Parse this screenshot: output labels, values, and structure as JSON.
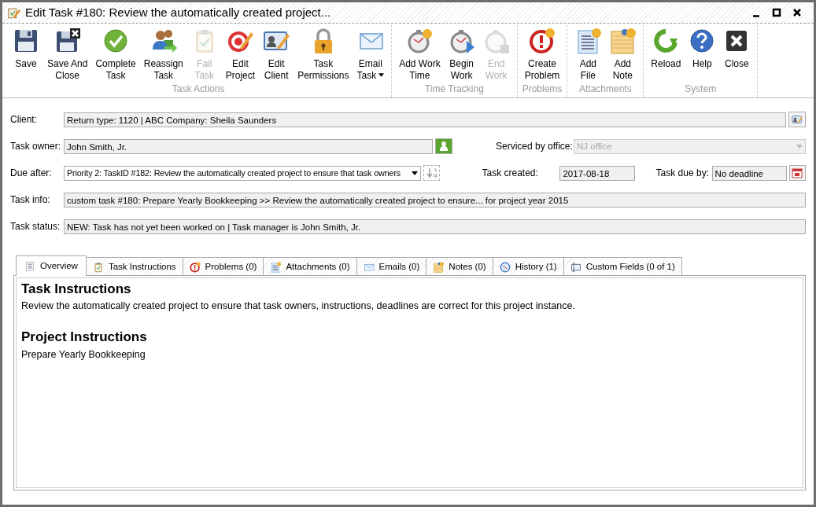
{
  "window": {
    "title": "Edit Task #180: Review the automatically created project..."
  },
  "toolbar_groups": [
    {
      "caption": "Task Actions",
      "buttons": [
        {
          "label": "Save",
          "disabled": false
        },
        {
          "label": "Save And\nClose",
          "disabled": false
        },
        {
          "label": "Complete\nTask",
          "disabled": false
        },
        {
          "label": "Reassign\nTask",
          "disabled": false
        },
        {
          "label": "Fail\nTask",
          "disabled": true
        },
        {
          "label": "Edit\nProject",
          "disabled": false
        },
        {
          "label": "Edit\nClient",
          "disabled": false
        },
        {
          "label": "Task\nPermissions",
          "disabled": false
        },
        {
          "label": "Email\nTask",
          "disabled": false,
          "dropdown": true
        }
      ]
    },
    {
      "caption": "Time Tracking",
      "buttons": [
        {
          "label": "Add Work\nTime",
          "disabled": false
        },
        {
          "label": "Begin\nWork",
          "disabled": false
        },
        {
          "label": "End\nWork",
          "disabled": true
        }
      ]
    },
    {
      "caption": "Problems",
      "buttons": [
        {
          "label": "Create\nProblem",
          "disabled": false
        }
      ]
    },
    {
      "caption": "Attachments",
      "buttons": [
        {
          "label": "Add\nFile",
          "disabled": false
        },
        {
          "label": "Add\nNote",
          "disabled": false
        }
      ]
    },
    {
      "caption": "System",
      "buttons": [
        {
          "label": "Reload",
          "disabled": false
        },
        {
          "label": "Help",
          "disabled": false
        },
        {
          "label": "Close",
          "disabled": false
        }
      ]
    }
  ],
  "form": {
    "client": {
      "label": "Client:",
      "value": "Return type: 1120 | ABC Company: Sheila Saunders"
    },
    "task_owner": {
      "label": "Task owner:",
      "value": "John Smith, Jr."
    },
    "serviced_by_office": {
      "label": "Serviced by office:",
      "value": "NJ office",
      "disabled": true
    },
    "due_after": {
      "label": "Due after:",
      "value": "Priority 2: TaskID #182: Review the automatically created project to ensure that task owners"
    },
    "task_created": {
      "label": "Task created:",
      "value": "2017-08-18"
    },
    "task_due_by": {
      "label": "Task due by:",
      "value": "No deadline"
    },
    "task_info": {
      "label": "Task info:",
      "value": "custom task #180: Prepare Yearly Bookkeeping >> Review the automatically created project to ensure... for project year 2015"
    },
    "task_status": {
      "label": "Task status:",
      "value": "NEW: Task has not yet been worked on | Task manager is John Smith, Jr."
    }
  },
  "tabs": [
    {
      "label": "Overview",
      "selected": true
    },
    {
      "label": "Task Instructions",
      "selected": false
    },
    {
      "label": "Problems (0)",
      "selected": false
    },
    {
      "label": "Attachments (0)",
      "selected": false
    },
    {
      "label": "Emails (0)",
      "selected": false
    },
    {
      "label": "Notes (0)",
      "selected": false
    },
    {
      "label": "History (1)",
      "selected": false
    },
    {
      "label": "Custom Fields (0 of 1)",
      "selected": false
    }
  ],
  "overview": [
    {
      "heading": "Task Instructions",
      "text": "Review the automatically created project to ensure that task owners, instructions, deadlines are correct for this project instance."
    },
    {
      "heading": "Project Instructions",
      "text": "Prepare Yearly Bookkeeping"
    }
  ]
}
